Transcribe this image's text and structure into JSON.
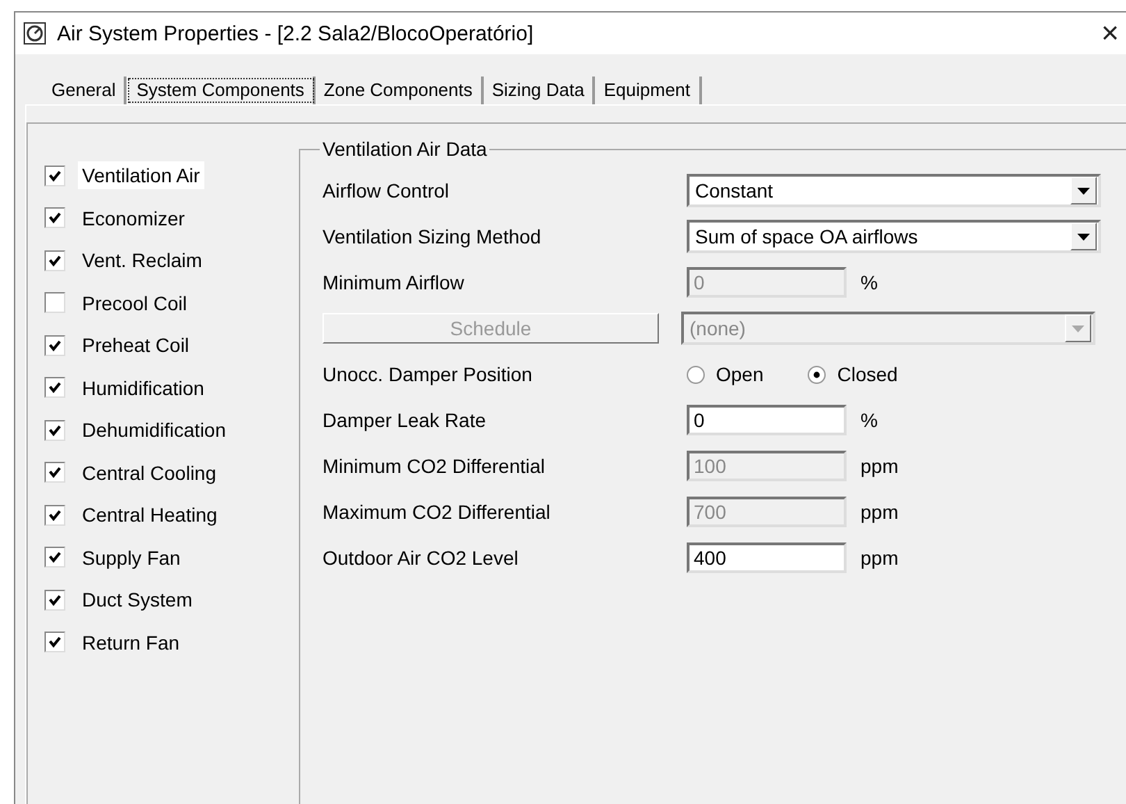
{
  "window": {
    "title": "Air System Properties - [2.2 Sala2/BlocoOperatório]",
    "close": "×"
  },
  "tabs": [
    {
      "label": "General",
      "selected": false
    },
    {
      "label": "System Components",
      "selected": true
    },
    {
      "label": "Zone Components",
      "selected": false
    },
    {
      "label": "Sizing Data",
      "selected": false
    },
    {
      "label": "Equipment",
      "selected": false
    }
  ],
  "components": [
    {
      "label": "Ventilation Air",
      "checked": true,
      "selected": true
    },
    {
      "label": "Economizer",
      "checked": true,
      "selected": false
    },
    {
      "label": "Vent. Reclaim",
      "checked": true,
      "selected": false
    },
    {
      "label": "Precool Coil",
      "checked": false,
      "selected": false
    },
    {
      "label": "Preheat Coil",
      "checked": true,
      "selected": false
    },
    {
      "label": "Humidification",
      "checked": true,
      "selected": false
    },
    {
      "label": "Dehumidification",
      "checked": true,
      "selected": false
    },
    {
      "label": "Central Cooling",
      "checked": true,
      "selected": false
    },
    {
      "label": "Central Heating",
      "checked": true,
      "selected": false
    },
    {
      "label": "Supply Fan",
      "checked": true,
      "selected": false
    },
    {
      "label": "Duct System",
      "checked": true,
      "selected": false
    },
    {
      "label": "Return Fan",
      "checked": true,
      "selected": false
    }
  ],
  "group": {
    "title": "Ventilation Air Data",
    "rows": [
      {
        "kind": "select",
        "label": "Airflow Control",
        "value": "Constant",
        "disabled": false
      },
      {
        "kind": "select",
        "label": "Ventilation Sizing Method",
        "value": "Sum of space OA airflows",
        "disabled": false
      },
      {
        "kind": "input",
        "label": "Minimum Airflow",
        "value": "0",
        "unit": "%",
        "disabled": true
      },
      {
        "kind": "schedule",
        "button": "Schedule",
        "value": "(none)",
        "disabled": true
      },
      {
        "kind": "radio",
        "label": "Unocc. Damper Position",
        "options": [
          {
            "label": "Open",
            "selected": false
          },
          {
            "label": "Closed",
            "selected": true
          }
        ]
      },
      {
        "kind": "input",
        "label": "Damper Leak Rate",
        "value": "0",
        "unit": "%",
        "disabled": false
      },
      {
        "kind": "input",
        "label": "Minimum CO2 Differential",
        "value": "100",
        "unit": "ppm",
        "disabled": true
      },
      {
        "kind": "input",
        "label": "Maximum CO2 Differential",
        "value": "700",
        "unit": "ppm",
        "disabled": true
      },
      {
        "kind": "input",
        "label": "Outdoor Air CO2 Level",
        "value": "400",
        "unit": "ppm",
        "disabled": false
      }
    ]
  }
}
